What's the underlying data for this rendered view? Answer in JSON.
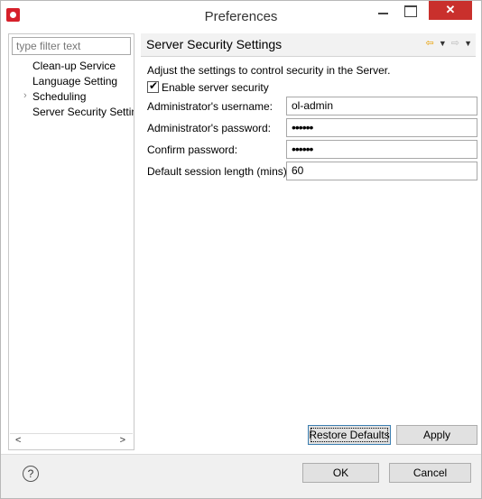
{
  "window": {
    "title": "Preferences",
    "close_glyph": "✕"
  },
  "filter": {
    "placeholder": "type filter text"
  },
  "tree": {
    "items": [
      {
        "label": "Clean-up Service"
      },
      {
        "label": "Language Setting"
      },
      {
        "label": "Scheduling",
        "expander": "›"
      },
      {
        "label": "Server Security Settings"
      }
    ],
    "scroll_left": "<",
    "scroll_right": ">"
  },
  "page": {
    "title": "Server Security Settings",
    "description": "Adjust the settings to control security in the Server.",
    "enable_label": "Enable server security",
    "enable_checked": true,
    "fields": {
      "username": {
        "label": "Administrator's username:",
        "value": "ol-admin"
      },
      "password": {
        "label": "Administrator's password:",
        "value": "••••••"
      },
      "confirm": {
        "label": "Confirm password:",
        "value": "••••••"
      },
      "session": {
        "label": "Default session length (mins):",
        "value": "60"
      }
    },
    "nav": {
      "back": "⇦",
      "dropdown": "▼",
      "forward": "⇨",
      "menu": "▼"
    }
  },
  "buttons": {
    "restore_defaults": "Restore Defaults",
    "apply": "Apply",
    "ok": "OK",
    "cancel": "Cancel"
  },
  "help": {
    "glyph": "?"
  },
  "colors": {
    "close_button": "#c9302c",
    "header_bg": "#f2f2f2",
    "footer_bg": "#f0f0f0",
    "nav_arrow": "#e8a000"
  }
}
